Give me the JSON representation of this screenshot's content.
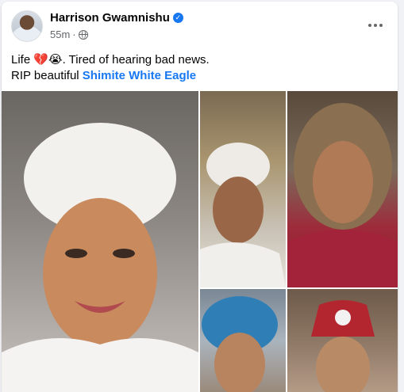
{
  "post": {
    "author": "Harrison Gwamnishu",
    "time": "55m",
    "separator": "·",
    "verified_glyph": "✓",
    "text_line1_prefix": "Life ",
    "emoji": "💔😭",
    "text_line1_suffix": ". Tired of hearing bad news.",
    "text_line2_prefix": "RIP beautiful ",
    "tagged_name": "Shimite White Eagle"
  },
  "icons": {
    "verified": "verified-badge-icon",
    "audience": "globe-icon",
    "more": "more-options-icon"
  },
  "colors": {
    "link": "#1877f2",
    "meta": "#65676b",
    "verified": "#1877f2"
  }
}
